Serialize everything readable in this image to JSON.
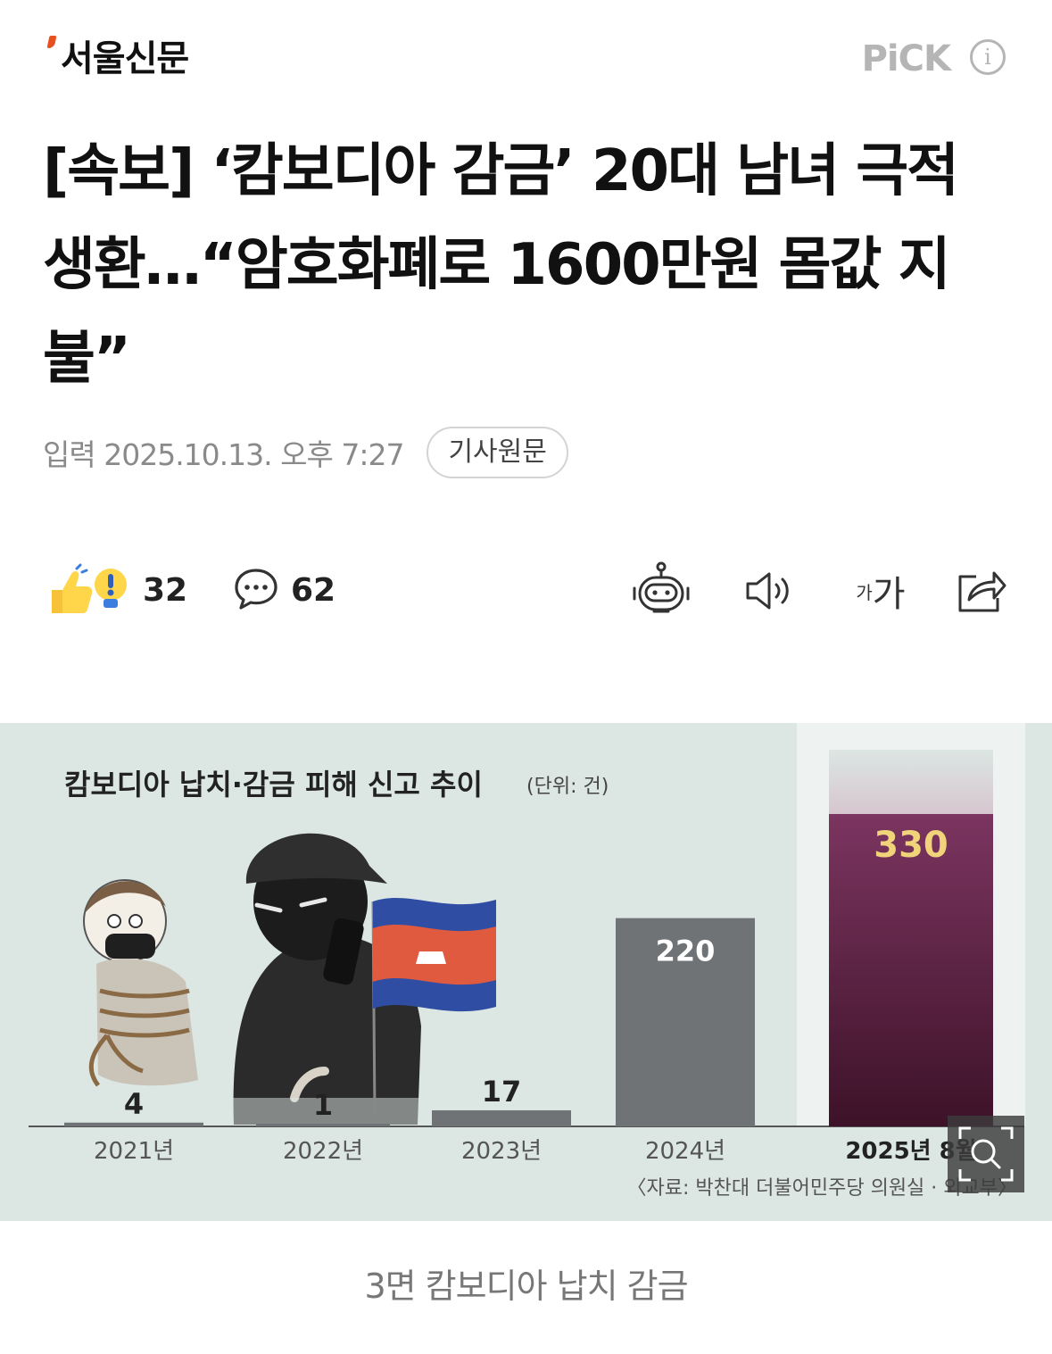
{
  "header": {
    "logo_text": "서울신문",
    "pick_label": "PiCK",
    "info_icon": "info-icon"
  },
  "article": {
    "headline": "[속보] ‘캄보디아 감금’ 20대 남녀 극적 생환…“암호화폐로 1600만원 몸값 지불”",
    "date": "입력 2025.10.13. 오후 7:27",
    "original_button": "기사원문"
  },
  "actions": {
    "reaction_count": "32",
    "comment_count": "62",
    "icons": [
      "robot-summary-icon",
      "speaker-icon",
      "font-size-icon",
      "share-icon"
    ],
    "font_small": "가",
    "font_big": "가"
  },
  "chart_data": {
    "type": "bar",
    "title": "캄보디아 납치·감금 피해 신고 추이",
    "unit": "(단위: 건)",
    "categories": [
      "2021년",
      "2022년",
      "2023년",
      "2024년",
      "2025년 8월"
    ],
    "values": [
      4,
      1,
      17,
      220,
      330
    ],
    "value_labels": [
      "4",
      "1",
      "17",
      "220",
      "330"
    ],
    "source": "〈자료: 박찬대 더불어민주당 의원실 · 외교부〉",
    "colors": {
      "bar": "#6f7375",
      "highlight_bar": "#6e2c52",
      "highlight_label": "#f1d37a",
      "background": "#dce6e3"
    }
  },
  "caption": "3면 캄보디아 납치 감금"
}
